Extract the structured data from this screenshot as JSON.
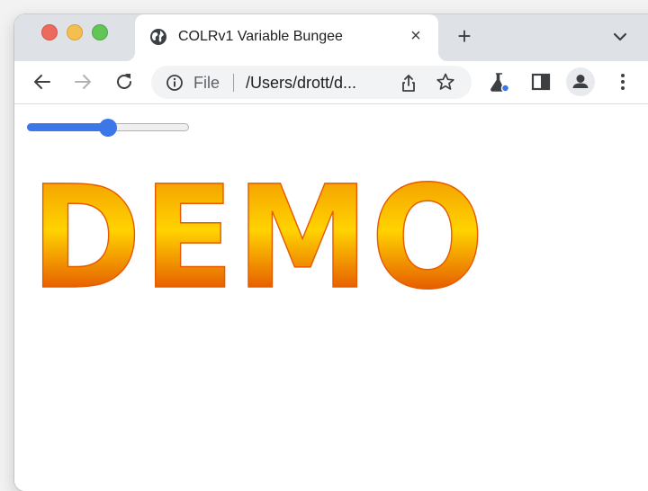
{
  "tab": {
    "title": "COLRv1 Variable Bungee",
    "favicon": "globe-icon",
    "close": "×"
  },
  "tabstrip": {
    "new_tab": "+",
    "tab_search_icon": "chevron-down-icon"
  },
  "toolbar": {
    "back_icon": "arrow-left-icon",
    "forward_icon": "arrow-right-icon",
    "reload_icon": "reload-icon",
    "extension_icon": "flask-icon",
    "side_panel_icon": "side-panel-icon",
    "profile_icon": "avatar-icon",
    "menu_icon": "more-vert-icon"
  },
  "omnibox": {
    "scheme_label": "File",
    "url": "/Users/drott/d...",
    "info_icon": "info-icon",
    "share_icon": "share-icon",
    "bookmark_icon": "star-icon"
  },
  "page": {
    "slider_value": 0.5,
    "demo_text": "DEMO"
  },
  "colors": {
    "window_frame": "#dee1e6",
    "accent": "#3b77e8",
    "gradient_top": "#ffd300",
    "gradient_bottom": "#d81e00"
  }
}
